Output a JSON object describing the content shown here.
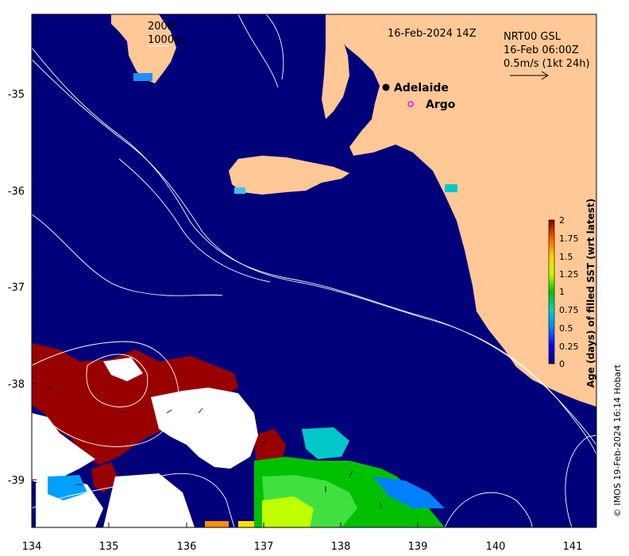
{
  "map": {
    "title_date": "16-Feb-2024 14Z",
    "product_line1": "NRT00 GSL",
    "product_line2": "16-Feb 06:00Z",
    "scale_label": "0.5m/s (1kt 24h)",
    "contour_label_200": "200m",
    "contour_label_1000": "1000m",
    "city_label": "Adelaide",
    "argo_label": "Argo",
    "credit": "© IMOS 19-Feb-2024 16:14 Hobart",
    "colors": {
      "ocean": "#00007a",
      "land": "#ffc896",
      "no_data": "#ffffff",
      "stale_2day": "#990000",
      "argo_marker": "#ff00ff"
    }
  },
  "axes": {
    "x_ticks": [
      "134",
      "135",
      "136",
      "137",
      "138",
      "139",
      "140",
      "141"
    ],
    "y_ticks": [
      "-35",
      "-36",
      "-37",
      "-38",
      "-39"
    ],
    "xlim": [
      134,
      141.3
    ],
    "ylim": [
      -39.5,
      -33.9
    ]
  },
  "colorbar": {
    "label": "Age (days) of filled SST (wrt latest)",
    "ticks": [
      "2",
      "1.75",
      "1.5",
      "1.25",
      "1",
      "0.75",
      "0.5",
      "0.25",
      "0"
    ],
    "range": [
      0,
      2
    ]
  }
}
